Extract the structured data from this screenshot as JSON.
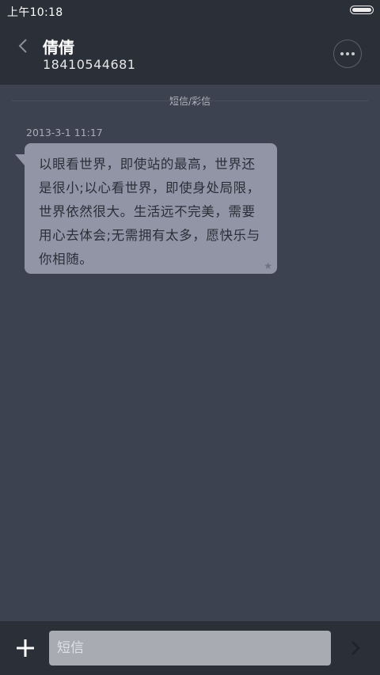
{
  "status_bar": {
    "time": "上午10:18",
    "battery_icon": "battery-full-icon"
  },
  "header": {
    "back_icon": "chevron-left-icon",
    "contact_name": "倩倩",
    "contact_number": "18410544681",
    "more_icon": "more-horizontal-icon"
  },
  "conversation": {
    "channel_label": "短信/彩信",
    "messages": [
      {
        "timestamp": "2013-3-1 11:17",
        "text": "以眼看世界，即使站的最高，世界还是很小;以心看世界，即使身处局限，世界依然很大。生活远不完美，需要用心去体会;无需拥有太多，愿快乐与你相随。",
        "star_icon": "star-icon",
        "starred": false
      }
    ]
  },
  "composer": {
    "add_icon": "plus-icon",
    "placeholder": "短信",
    "value": "",
    "send_icon": "send-chevron-icon"
  },
  "colors": {
    "background": "#3d4250",
    "bar": "#2b2f38",
    "bubble": "#9195a6",
    "input": "#a9abb3"
  }
}
